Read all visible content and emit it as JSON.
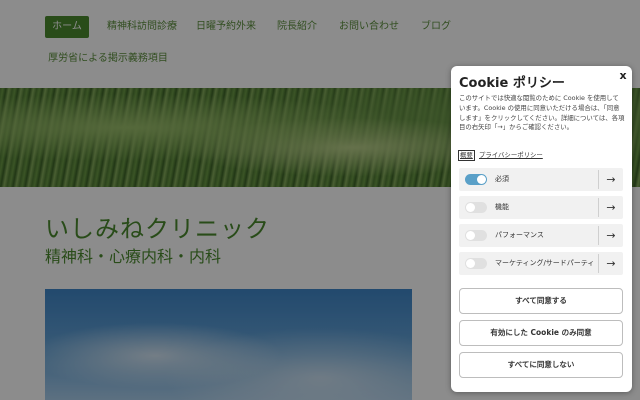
{
  "nav": {
    "items": [
      {
        "label": "ホーム",
        "active": true
      },
      {
        "label": "精神科訪問診療",
        "active": false
      },
      {
        "label": "日曜予約外来",
        "active": false
      },
      {
        "label": "院長紹介",
        "active": false
      },
      {
        "label": "お問い合わせ",
        "active": false
      },
      {
        "label": "ブログ",
        "active": false
      },
      {
        "label": "厚労省による掲示義務項目",
        "active": false
      }
    ]
  },
  "site": {
    "title": "いしみねクリニック",
    "subtitle": "精神科・心療内科・内科"
  },
  "cookie": {
    "title": "Cookie ポリシー",
    "close_glyph": "x",
    "description": "このサイトでは快適な閲覧のために Cookie を使用しています。Cookie の使用に同意いただける場合は、「同意します」をクリックしてください。詳細については、各項目の右矢印「→」からご確認ください。",
    "summary_link": "概要",
    "privacy_link": "プライバシーポリシー",
    "categories": [
      {
        "label": "必須",
        "enabled": true,
        "arrow": "→"
      },
      {
        "label": "機能",
        "enabled": false,
        "arrow": "→"
      },
      {
        "label": "パフォーマンス",
        "enabled": false,
        "arrow": "→"
      },
      {
        "label": "マーケティング/サードパーティ",
        "enabled": false,
        "arrow": "→"
      }
    ],
    "buttons": {
      "accept_all": "すべて同意する",
      "accept_enabled": "有効にした Cookie のみ同意",
      "reject_all": "すべてに同意しない"
    }
  },
  "colors": {
    "brand_green": "#4b8a2f",
    "toggle_on": "#5aa0c8"
  }
}
